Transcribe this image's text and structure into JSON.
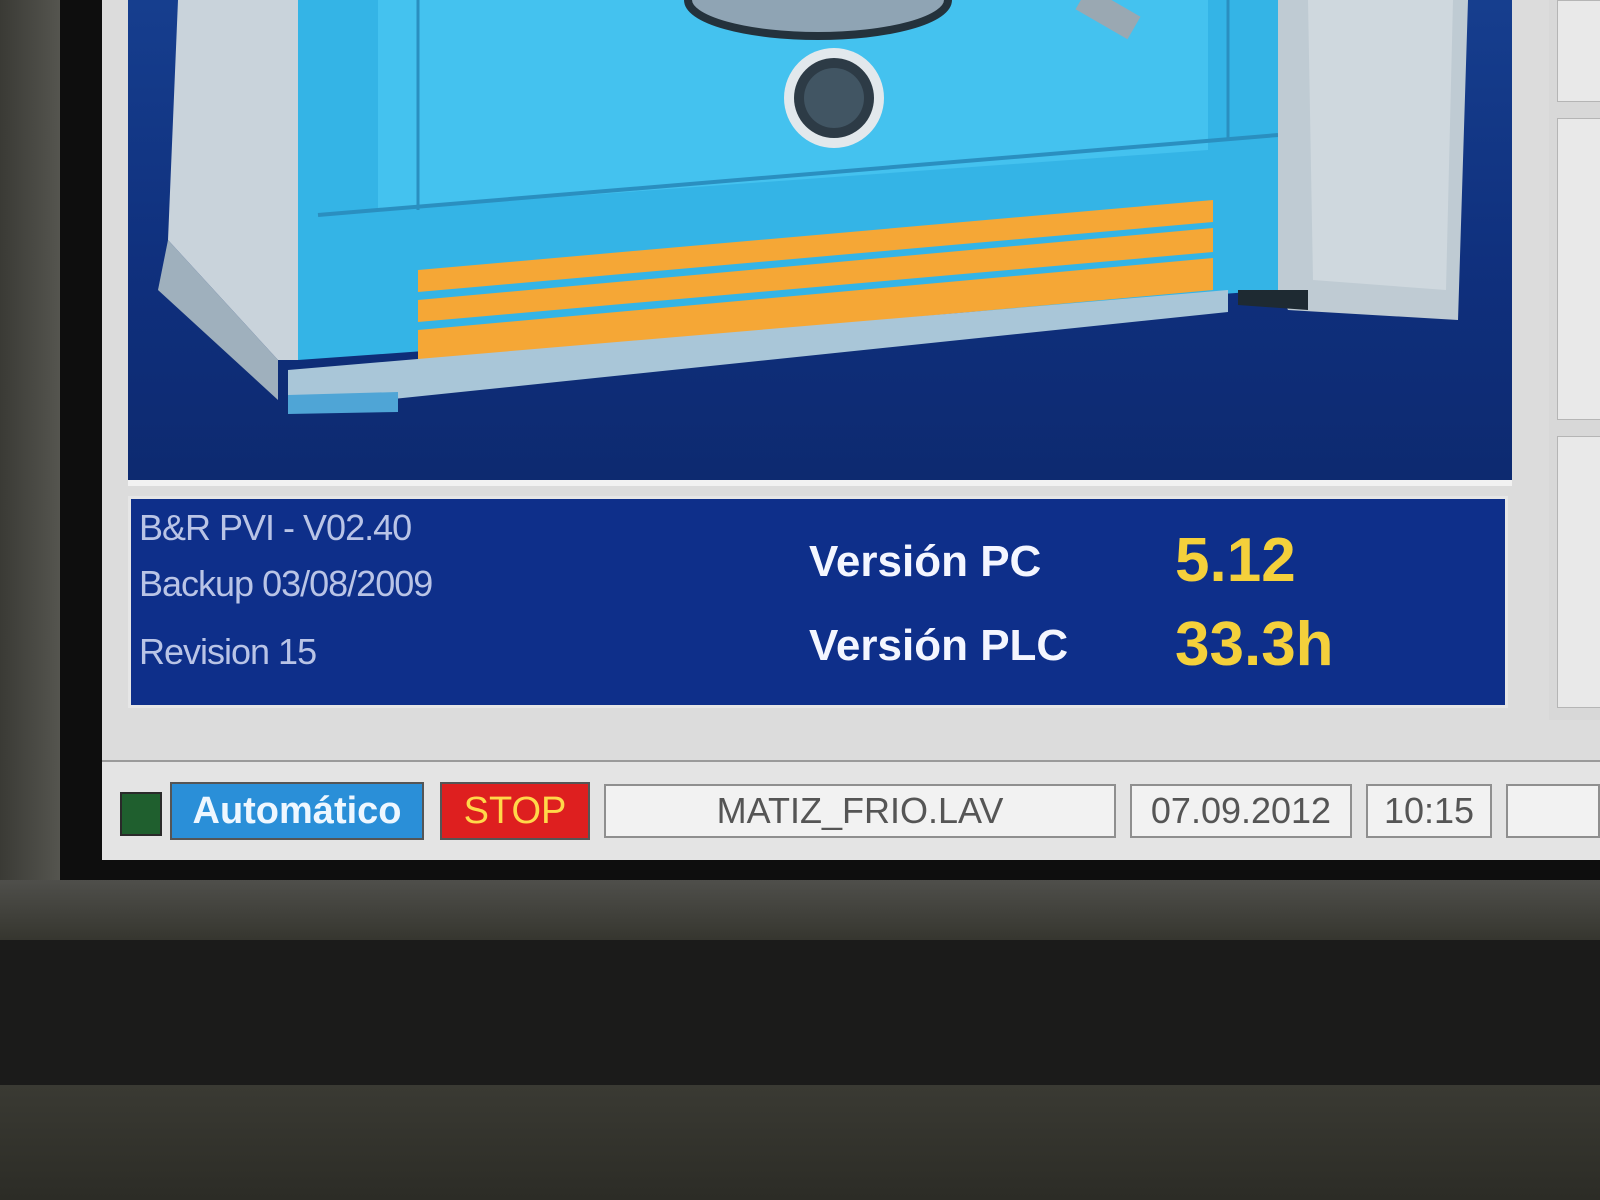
{
  "info_panel": {
    "pvi_version": "B&R PVI - V02.40",
    "backup": "Backup 03/08/2009",
    "revision": "Revision 15",
    "pc_label": "Versión PC",
    "pc_value": "5.12",
    "plc_label": "Versión PLC",
    "plc_value": "33.3h"
  },
  "status_bar": {
    "mode_label": "Automático",
    "stop_label": "STOP",
    "program_file": "MATIZ_FRIO.LAV",
    "date": "07.09.2012",
    "time": "10:15"
  },
  "colors": {
    "panel_blue": "#0e2f8a",
    "value_yellow": "#f4d03b",
    "mode_blue": "#2a8fd8",
    "stop_red": "#de1f1f",
    "status_led": "#1f5f2e"
  }
}
